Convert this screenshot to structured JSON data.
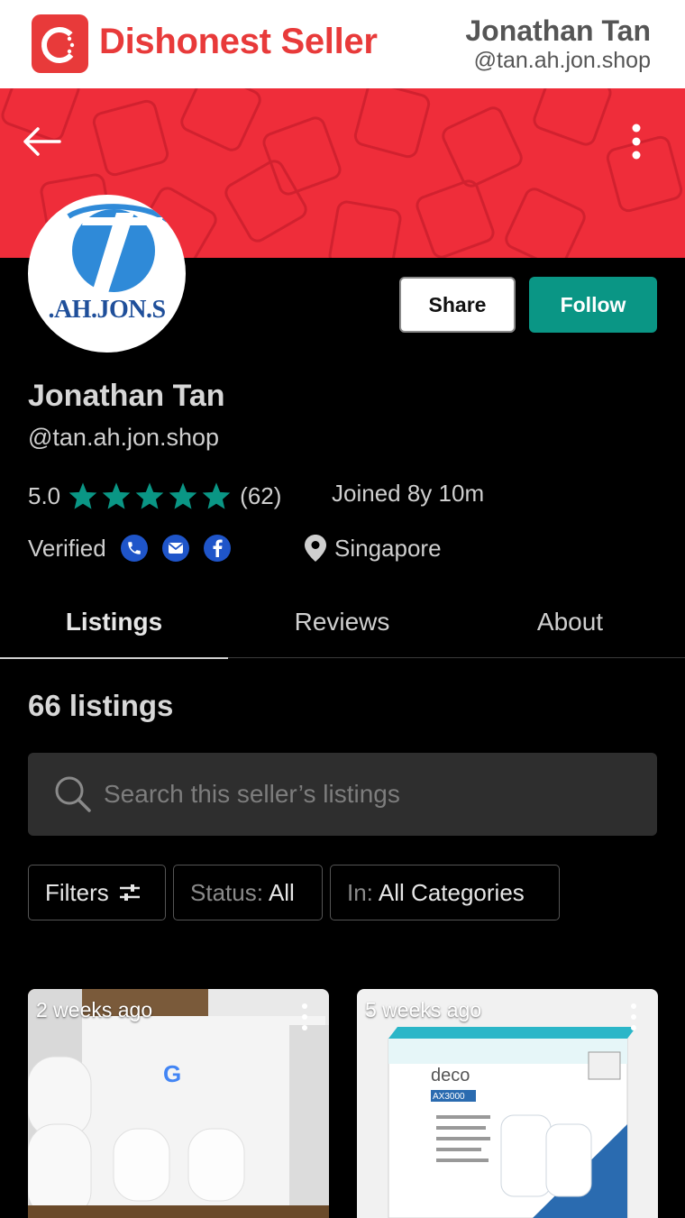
{
  "header": {
    "brand": "Dishonest Seller",
    "user_name": "Jonathan Tan",
    "user_handle": "@tan.ah.jon.shop",
    "brand_color": "#e83a3a"
  },
  "profile": {
    "avatar_text": ".AH.JON.S",
    "name": "Jonathan Tan",
    "handle": "@tan.ah.jon.shop",
    "rating": "5.0",
    "stars": 5,
    "review_count": "(62)",
    "joined": "Joined 8y 10m",
    "verified_label": "Verified",
    "verified_icons": [
      "phone-icon",
      "email-icon",
      "facebook-icon"
    ],
    "location": "Singapore"
  },
  "actions": {
    "share_label": "Share",
    "follow_label": "Follow",
    "follow_color": "#0a9685"
  },
  "tabs": [
    {
      "label": "Listings",
      "active": true
    },
    {
      "label": "Reviews",
      "active": false
    },
    {
      "label": "About",
      "active": false
    }
  ],
  "listings": {
    "count_label": "66 listings",
    "search_placeholder": "Search this seller’s listings",
    "filters_label": "Filters",
    "status_prefix": "Status:",
    "status_value": "All",
    "category_prefix": "In:",
    "category_value": "All Categories",
    "items": [
      {
        "time": "2 weeks ago"
      },
      {
        "time": "5 weeks ago"
      }
    ]
  }
}
